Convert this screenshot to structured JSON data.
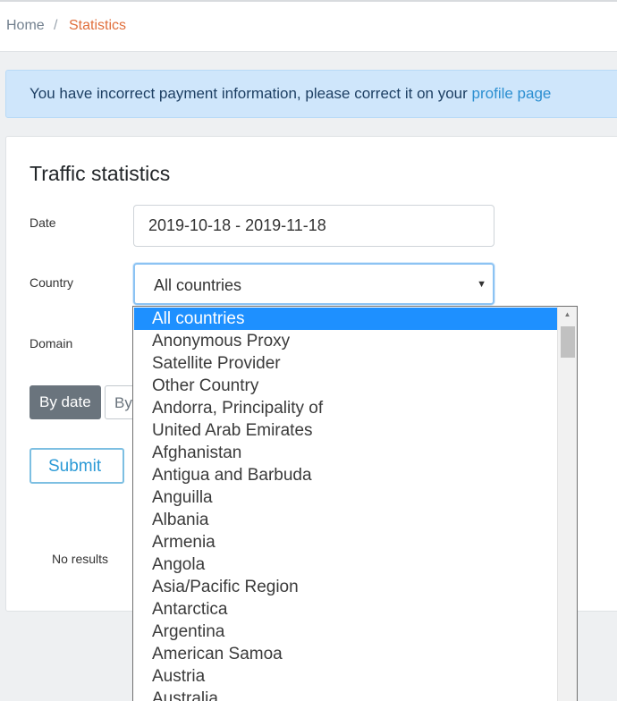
{
  "breadcrumb": {
    "home": "Home",
    "separator": "/",
    "current": "Statistics"
  },
  "alert": {
    "message": "You have incorrect payment information, please correct it on your ",
    "link": "profile page"
  },
  "card": {
    "title": "Traffic statistics"
  },
  "form": {
    "date_label": "Date",
    "date_value": "2019-10-18 - 2019-11-18",
    "country_label": "Country",
    "country_value": "All countries",
    "domain_label": "Domain",
    "group_by_date": "By date",
    "group_by_other_partial": "By",
    "submit": "Submit"
  },
  "results": {
    "empty_text": "No results"
  },
  "country_options": [
    "All countries",
    "Anonymous Proxy",
    "Satellite Provider",
    "Other Country",
    "Andorra, Principality of",
    "United Arab Emirates",
    "Afghanistan",
    "Antigua and Barbuda",
    "Anguilla",
    "Albania",
    "Armenia",
    "Angola",
    "Asia/Pacific Region",
    "Antarctica",
    "Argentina",
    "American Samoa",
    "Austria",
    "Australia"
  ],
  "colors": {
    "accent": "#1e90ff",
    "breadcrumb_active": "#e06f3c",
    "alert_bg": "#cfe6fb",
    "link": "#2c8fd1"
  }
}
